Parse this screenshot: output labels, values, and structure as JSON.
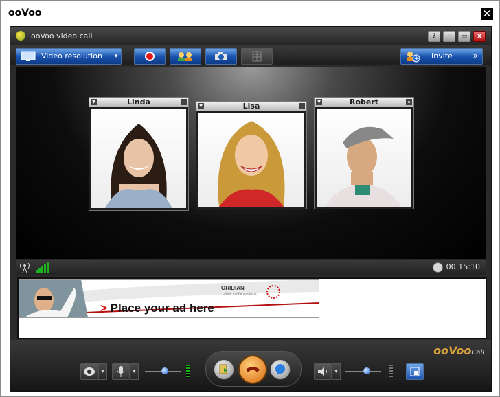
{
  "outer": {
    "title": "ooVoo",
    "close_glyph": "✕"
  },
  "app": {
    "title": "ooVoo video call",
    "window_buttons": [
      "?",
      "–",
      "▭",
      "x"
    ]
  },
  "toolbar": {
    "video_resolution_label": "Video resolution",
    "invite_label": "Invite",
    "invite_chevron": "»",
    "dropdown_glyph": "▾"
  },
  "participants": [
    {
      "name": "Linda"
    },
    {
      "name": "Lisa"
    },
    {
      "name": "Robert"
    }
  ],
  "status": {
    "time": "00:15:10",
    "signal_bars": 5
  },
  "ad": {
    "brand": "ORIDIAN",
    "brand_tagline": "online media solutions",
    "arrow": ">",
    "text": "Place your ad here"
  },
  "branding": {
    "logo": "ooVoo",
    "sub": "Call"
  },
  "controls": {
    "mic_volume": 0.55,
    "speaker_volume": 0.6,
    "dropdown_glyph": "▾"
  },
  "colors": {
    "accent_blue": "#1b55b0",
    "end_call": "#e07b1c",
    "signal_green": "#1bb21b",
    "ad_red": "#d41414"
  }
}
